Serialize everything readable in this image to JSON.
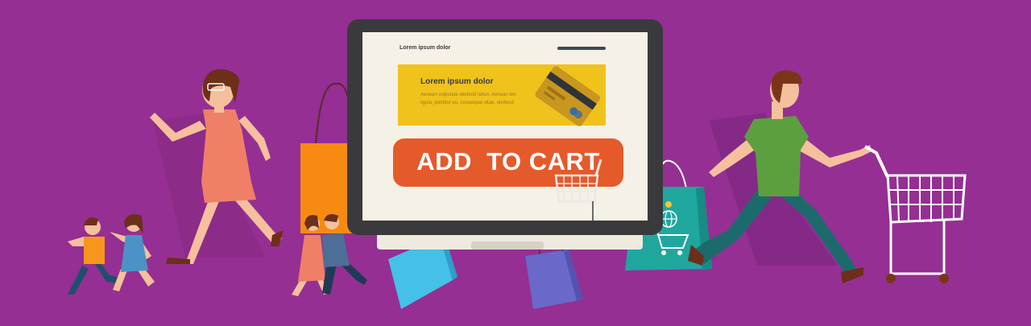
{
  "screen": {
    "title": "Lorem ipsum dolor",
    "banner_heading": "Lorem ipsum dolor",
    "banner_text": "Aenean vulputate eleifend tellus. Aenean leo ligula, porttitor eu, consequat vitae, eleifend",
    "cta_label": "ADD  TO CART"
  },
  "colors": {
    "background": "#952f93",
    "banner": "#f0c21c",
    "button": "#e55a2b",
    "monitor_frame": "#3a3a3c"
  },
  "icons": [
    "credit-card-icon",
    "shopping-cart-icon",
    "globe-pin-icon",
    "shopping-bag-icon"
  ]
}
